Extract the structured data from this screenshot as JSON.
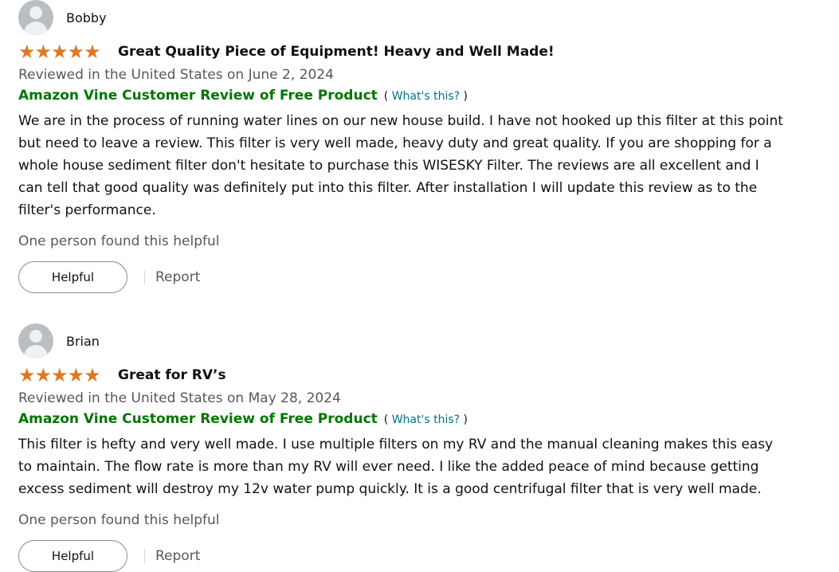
{
  "colors": {
    "star": "#de7921",
    "vine_green": "#007600",
    "link_teal": "#007185",
    "muted_text": "#565959"
  },
  "reviews": [
    {
      "profile_name": "Bobby",
      "rating": 5,
      "rating_display": "★★★★★",
      "title": "Great Quality Piece of Equipment! Heavy and Well Made!",
      "date": "Reviewed in the United States on June 2, 2024",
      "vine_label": "Amazon Vine Customer Review of Free Product",
      "whats_this_open": "(",
      "whats_this_label": "What's this?",
      "whats_this_close": ")",
      "body": "We are in the process of running water lines on our new house build. I have not hooked up this filter at this point but need to leave a review. This filter is very well made, heavy duty and great quality. If you are shopping for a whole house sediment filter don't hesitate to purchase this WISESKY Filter. The reviews are all excellent and I can tell that good quality was definitely put into this filter. After installation I will update this review as to the filter's performance.",
      "helpful_count": "One person found this helpful",
      "helpful_button": "Helpful",
      "report_label": "Report"
    },
    {
      "profile_name": "Brian",
      "rating": 5,
      "rating_display": "★★★★★",
      "title": "Great for RV’s",
      "date": "Reviewed in the United States on May 28, 2024",
      "vine_label": "Amazon Vine Customer Review of Free Product",
      "whats_this_open": "(",
      "whats_this_label": "What's this?",
      "whats_this_close": ")",
      "body": "This filter is hefty and very well made. I use multiple filters on my RV and the manual cleaning makes this easy to maintain. The flow rate is more than my RV will ever need. I like the added peace of mind because getting excess sediment will destroy my 12v water pump quickly. It is a good centrifugal filter that is very well made.",
      "helpful_count": "One person found this helpful",
      "helpful_button": "Helpful",
      "report_label": "Report"
    }
  ]
}
